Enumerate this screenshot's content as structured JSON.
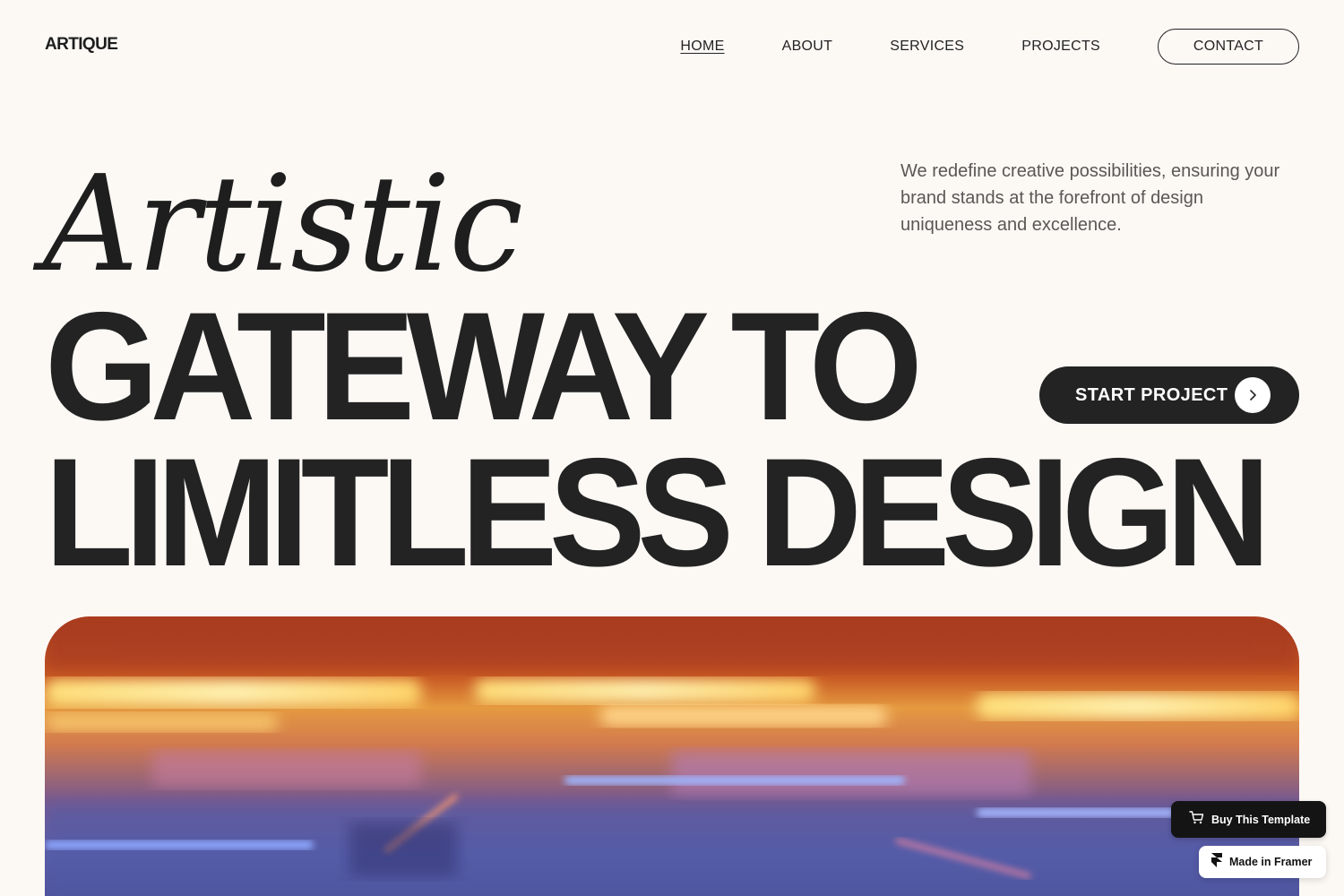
{
  "header": {
    "logo": "ARTIQUE",
    "nav": [
      {
        "label": "HOME",
        "active": true
      },
      {
        "label": "ABOUT",
        "active": false
      },
      {
        "label": "SERVICES",
        "active": false
      },
      {
        "label": "PROJECTS",
        "active": false
      }
    ],
    "contact_label": "CONTACT"
  },
  "hero": {
    "script_word": "Artistic",
    "tagline": "We redefine creative possibilities, ensuring your brand stands at the forefront of design uniqueness and excellence.",
    "headline_line1": "GATEWAY TO",
    "headline_line2": "LIMITLESS DESIGN",
    "cta_label": "START PROJECT",
    "cta_icon": "chevron-right-icon"
  },
  "badges": {
    "buy_label": "Buy This Template",
    "buy_icon": "cart-icon",
    "framer_label": "Made in Framer",
    "framer_icon": "framer-logo-icon"
  },
  "colors": {
    "background": "#fcf9f5",
    "text": "#232323",
    "button_dark": "#232323"
  }
}
